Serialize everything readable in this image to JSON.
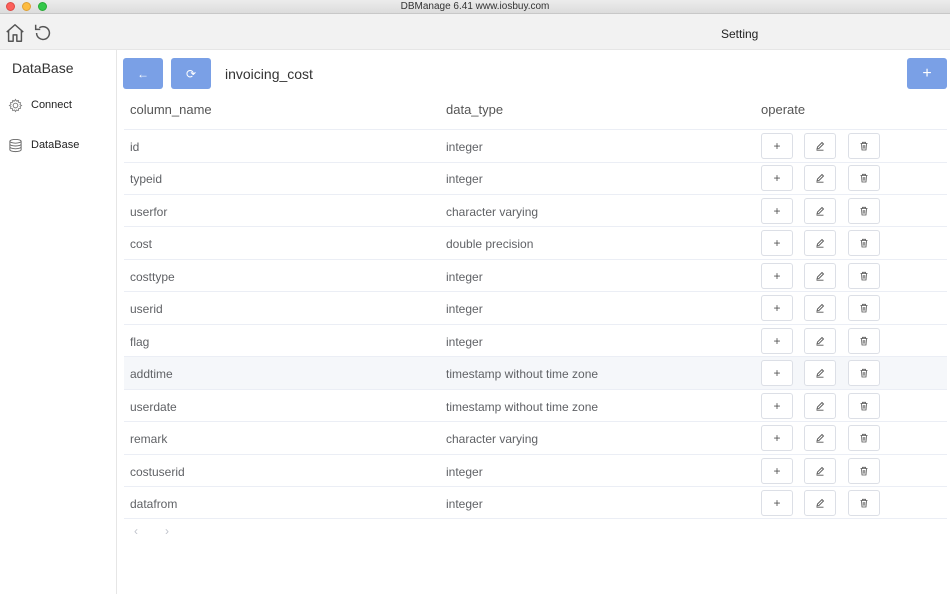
{
  "window": {
    "title": "DBManage 6.41 www.iosbuy.com"
  },
  "topbar": {
    "title": "Setting",
    "home_icon": "home-icon",
    "refresh_icon": "refresh-icon"
  },
  "sidebar": {
    "title": "DataBase",
    "items": [
      {
        "label": "Connect",
        "icon": "gear-icon"
      },
      {
        "label": "DataBase",
        "icon": "database-icon"
      }
    ]
  },
  "toolbar": {
    "back_label": "←",
    "refresh_label": "⟳",
    "add_label": "+",
    "table_name": "invoicing_cost"
  },
  "table": {
    "headers": {
      "col1": "column_name",
      "col2": "data_type",
      "col3": "operate"
    },
    "rows": [
      {
        "name": "id",
        "type": "integer"
      },
      {
        "name": "typeid",
        "type": "integer"
      },
      {
        "name": "userfor",
        "type": "character varying"
      },
      {
        "name": "cost",
        "type": "double precision"
      },
      {
        "name": "costtype",
        "type": "integer"
      },
      {
        "name": "userid",
        "type": "integer"
      },
      {
        "name": "flag",
        "type": "integer"
      },
      {
        "name": "addtime",
        "type": "timestamp without time zone"
      },
      {
        "name": "userdate",
        "type": "timestamp without time zone"
      },
      {
        "name": "remark",
        "type": "character varying"
      },
      {
        "name": "costuserid",
        "type": "integer"
      },
      {
        "name": "datafrom",
        "type": "integer"
      }
    ],
    "highlighted_row": 7,
    "op_labels": {
      "add": "+"
    }
  },
  "pager": {
    "prev": "‹",
    "next": "›"
  },
  "colors": {
    "accent": "#7aa0e6",
    "border": "#ebeef5",
    "row_hover": "#f5f7fa"
  }
}
